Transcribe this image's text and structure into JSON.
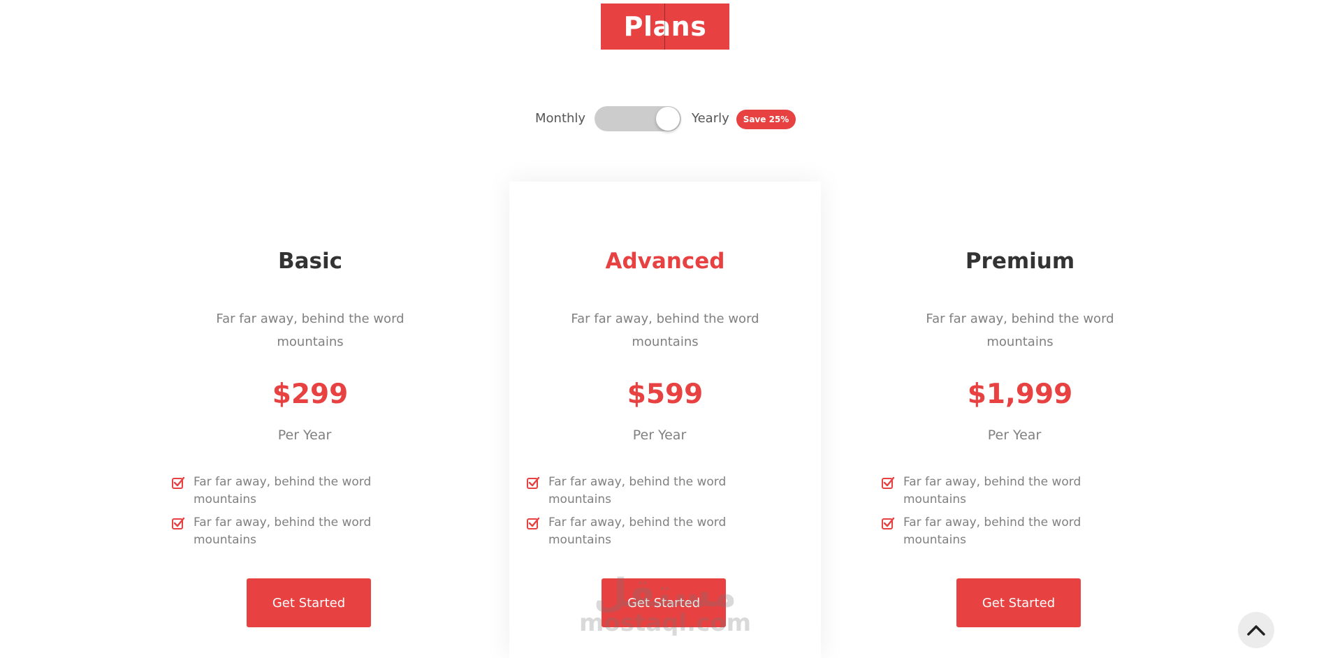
{
  "header": {
    "title": "Plans"
  },
  "billing_toggle": {
    "monthly_label": "Monthly",
    "yearly_label": "Yearly",
    "save_badge": "Save 25%",
    "selected": "Yearly"
  },
  "plans": [
    {
      "name": "Basic",
      "description": "Far far away, behind the word mountains",
      "price": "$299",
      "period": "Per Year",
      "features": [
        "Far far away, behind the word mountains",
        "Far far away, behind the word mountains"
      ],
      "cta": "Get Started"
    },
    {
      "name": "Advanced",
      "description": "Far far away, behind the word mountains",
      "price": "$599",
      "period": "Per Year",
      "features": [
        "Far far away, behind the word mountains",
        "Far far away, behind the word mountains"
      ],
      "cta": "Get Started"
    },
    {
      "name": "Premium",
      "description": "Far far away, behind the word mountains",
      "price": "$1,999",
      "period": "Per Year",
      "features": [
        "Far far away, behind the word mountains",
        "Far far away, behind the word mountains"
      ],
      "cta": "Get Started"
    }
  ],
  "watermark": {
    "arabic": "مستقل",
    "latin": "mostaql.com"
  },
  "icons": {
    "feature_check": "check-square-icon",
    "scroll_top": "chevron-up-icon"
  },
  "colors": {
    "accent": "#e84141",
    "muted_text": "#808080",
    "heading_text": "#333333",
    "toggle_track": "#cccccc"
  }
}
